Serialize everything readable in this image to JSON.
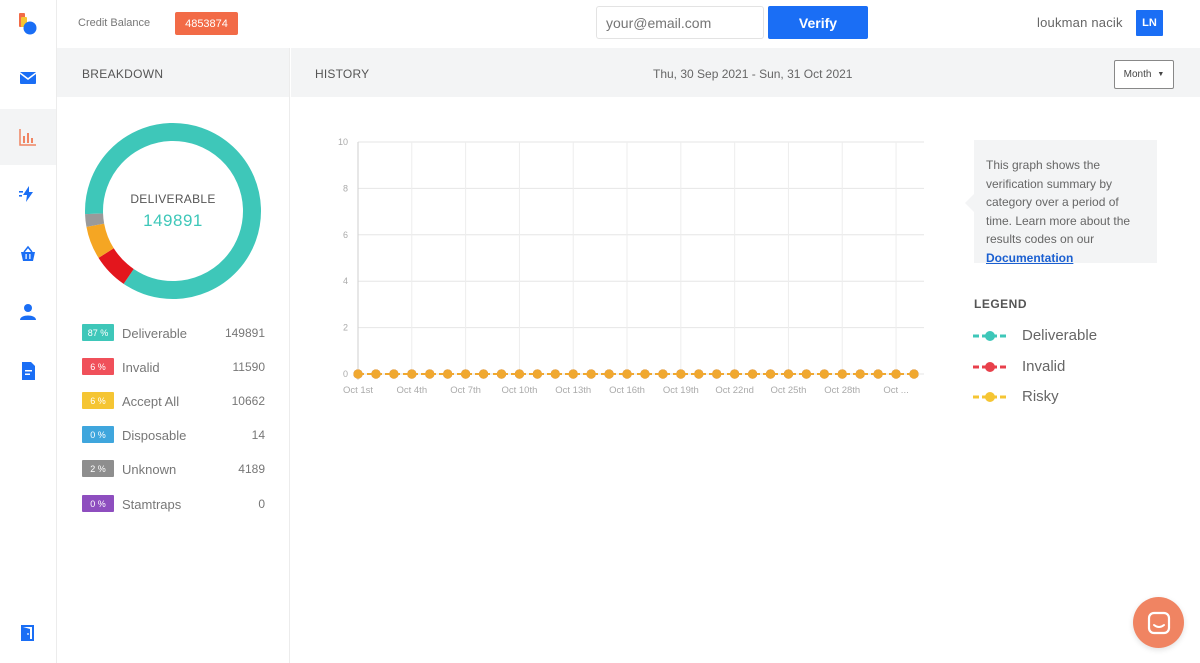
{
  "topbar": {
    "credit_label": "Credit Balance",
    "credit_value": "4853874",
    "email_placeholder": "your@email.com",
    "verify_label": "Verify",
    "user_name": "loukman nacik",
    "avatar_initials": "LN"
  },
  "sidebar": {
    "items": [
      {
        "icon": "mail-icon"
      },
      {
        "icon": "bar-chart-icon",
        "active": true
      },
      {
        "icon": "bolt-icon"
      },
      {
        "icon": "basket-icon"
      },
      {
        "icon": "user-icon"
      },
      {
        "icon": "document-icon"
      },
      {
        "icon": "logout-door-icon"
      }
    ]
  },
  "breakdown": {
    "title": "BREAKDOWN",
    "donut_label": "DELIVERABLE",
    "donut_value": "149891",
    "stats": [
      {
        "pct": "87 %",
        "name": "Deliverable",
        "value": "149891",
        "color": "#3ec7b9"
      },
      {
        "pct": "6 %",
        "name": "Invalid",
        "value": "11590",
        "color": "#f0505a"
      },
      {
        "pct": "6 %",
        "name": "Accept All",
        "value": "10662",
        "color": "#f5c533"
      },
      {
        "pct": "0 %",
        "name": "Disposable",
        "value": "14",
        "color": "#3fa6dd"
      },
      {
        "pct": "2 %",
        "name": "Unknown",
        "value": "4189",
        "color": "#8e8e8e"
      },
      {
        "pct": "0 %",
        "name": "Stamtraps",
        "value": "0",
        "color": "#8e4ebf"
      }
    ]
  },
  "history": {
    "title": "HISTORY",
    "date_range": "Thu, 30 Sep 2021 - Sun, 31 Oct 2021",
    "period_select": "Month",
    "info_text": "This graph shows the verification summary by category over a period of time. Learn more about the results codes on our",
    "info_link": "Documentation",
    "legend_title": "LEGEND",
    "legend": [
      {
        "label": "Deliverable",
        "color": "#3ec7b9"
      },
      {
        "label": "Invalid",
        "color": "#e8404b"
      },
      {
        "label": "Risky",
        "color": "#f5c533"
      }
    ]
  },
  "chart_data": {
    "type": "line",
    "y_ticks": [
      "0",
      "2",
      "4",
      "6",
      "8",
      "10"
    ],
    "ylim": [
      0,
      10
    ],
    "x_tick_labels": [
      "Oct 1st",
      "Oct 4th",
      "Oct 7th",
      "Oct 10th",
      "Oct 13th",
      "Oct 16th",
      "Oct 19th",
      "Oct 22nd",
      "Oct 25th",
      "Oct 28th",
      "Oct ..."
    ],
    "series": [
      {
        "name": "Deliverable",
        "color": "#3ec7b9",
        "values": [
          0,
          0,
          0,
          0,
          0,
          0,
          0,
          0,
          0,
          0,
          0,
          0,
          0,
          0,
          0,
          0,
          0,
          0,
          0,
          0,
          0,
          0,
          0,
          0,
          0,
          0,
          0,
          0,
          0,
          0,
          0,
          0
        ]
      },
      {
        "name": "Invalid",
        "color": "#e8404b",
        "values": [
          0,
          0,
          0,
          0,
          0,
          0,
          0,
          0,
          0,
          0,
          0,
          0,
          0,
          0,
          0,
          0,
          0,
          0,
          0,
          0,
          0,
          0,
          0,
          0,
          0,
          0,
          0,
          0,
          0,
          0,
          0,
          0
        ]
      },
      {
        "name": "Risky",
        "color": "#f0a830",
        "values": [
          0,
          0,
          0,
          0,
          0,
          0,
          0,
          0,
          0,
          0,
          0,
          0,
          0,
          0,
          0,
          0,
          0,
          0,
          0,
          0,
          0,
          0,
          0,
          0,
          0,
          0,
          0,
          0,
          0,
          0,
          0,
          0
        ]
      }
    ],
    "grid": true
  },
  "donut_data": {
    "segments": [
      {
        "name": "Deliverable",
        "value": 149891,
        "color": "#3ec7b9"
      },
      {
        "name": "Invalid",
        "value": 11590,
        "color": "#e3161d"
      },
      {
        "name": "Accept All",
        "value": 10662,
        "color": "#f5a623"
      },
      {
        "name": "Unknown",
        "value": 4189,
        "color": "#9a9a9a"
      }
    ]
  }
}
